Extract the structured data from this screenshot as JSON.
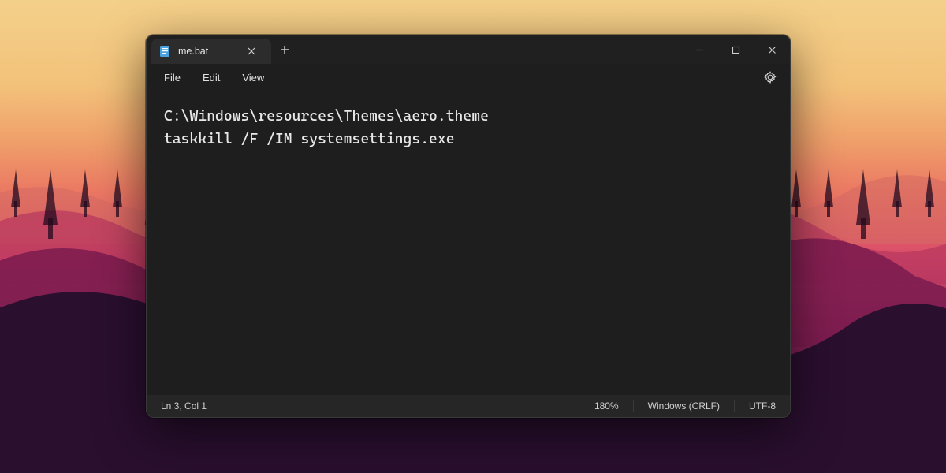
{
  "tab": {
    "title": "me.bat"
  },
  "menu": {
    "file": "File",
    "edit": "Edit",
    "view": "View"
  },
  "editor": {
    "line1": "C:\\Windows\\resources\\Themes\\aero.theme",
    "line2": "taskkill /F /IM systemsettings.exe"
  },
  "status": {
    "position": "Ln 3, Col 1",
    "zoom": "180%",
    "eol": "Windows (CRLF)",
    "encoding": "UTF-8"
  }
}
